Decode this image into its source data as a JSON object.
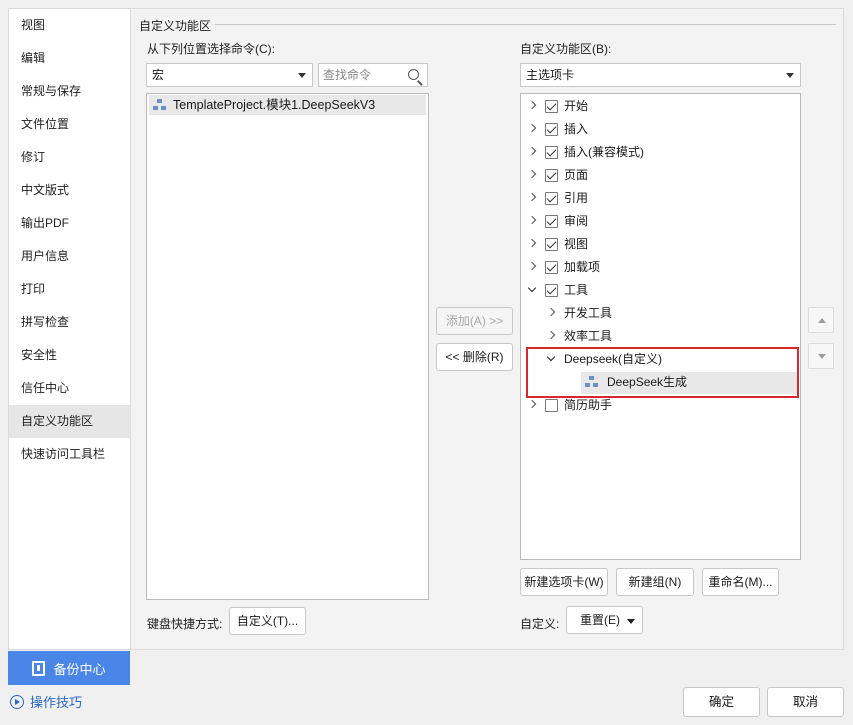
{
  "sidebar": {
    "items": [
      {
        "label": "视图"
      },
      {
        "label": "编辑"
      },
      {
        "label": "常规与保存"
      },
      {
        "label": "文件位置"
      },
      {
        "label": "修订"
      },
      {
        "label": "中文版式"
      },
      {
        "label": "输出PDF"
      },
      {
        "label": "用户信息"
      },
      {
        "label": "打印"
      },
      {
        "label": "拼写检查"
      },
      {
        "label": "安全性"
      },
      {
        "label": "信任中心"
      },
      {
        "label": "自定义功能区"
      },
      {
        "label": "快速访问工具栏"
      }
    ],
    "active_index": 12,
    "backup_label": "备份中心"
  },
  "main": {
    "group_title": "自定义功能区",
    "left": {
      "choose_label": "从下列位置选择命令(C):",
      "choose_value": "宏",
      "search_placeholder": "查找命令",
      "items": [
        "TemplateProject.模块1.DeepSeekV3"
      ]
    },
    "right": {
      "customize_label": "自定义功能区(B):",
      "customize_value": "主选项卡",
      "tree": [
        {
          "label": "开始",
          "checked": true
        },
        {
          "label": "插入",
          "checked": true
        },
        {
          "label": "插入(兼容模式)",
          "checked": true
        },
        {
          "label": "页面",
          "checked": true
        },
        {
          "label": "引用",
          "checked": true
        },
        {
          "label": "审阅",
          "checked": true
        },
        {
          "label": "视图",
          "checked": true
        },
        {
          "label": "加载项",
          "checked": true
        },
        {
          "label": "工具",
          "checked": true
        },
        {
          "label": "开发工具"
        },
        {
          "label": "效率工具"
        },
        {
          "label": "Deepseek(自定义)"
        },
        {
          "label": "DeepSeek生成"
        },
        {
          "label": "简历助手",
          "checked": false
        }
      ]
    },
    "add_button": "添加(A) >>",
    "remove_button": "<< 删除(R)",
    "new_tab_button": "新建选项卡(W)",
    "new_group_button": "新建组(N)",
    "rename_button": "重命名(M)...",
    "shortcut_label": "键盘快捷方式:",
    "shortcut_button": "自定义(T)...",
    "customize_label": "自定义:",
    "reset_button": "重置(E)"
  },
  "footer": {
    "tips_label": "操作技巧",
    "ok_label": "确定",
    "cancel_label": "取消"
  },
  "colors": {
    "accent": "#4a86e8",
    "highlight": "#d9272e",
    "link": "#2a67c8"
  }
}
